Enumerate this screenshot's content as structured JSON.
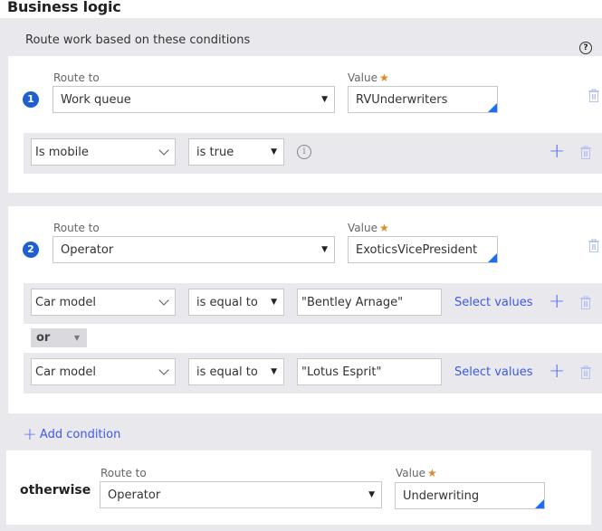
{
  "section_title": "Business logic",
  "subtitle": "Route work based on these conditions",
  "help_icon": "?",
  "labels": {
    "route_to": "Route to",
    "value": "Value",
    "required_marker": "★"
  },
  "routes": [
    {
      "number": "1",
      "route_to": "Work queue",
      "value": "RVUnderwriters",
      "conditions": [
        {
          "field": "Is mobile",
          "operator": "is true",
          "info_icon": "i"
        }
      ]
    },
    {
      "number": "2",
      "route_to": "Operator",
      "value": "ExoticsVicePresident",
      "conditions": [
        {
          "field": "Car model",
          "operator": "is equal to",
          "value": "\"Bentley Arnage\"",
          "select_values": "Select values"
        },
        {
          "field": "Car model",
          "operator": "is equal to",
          "value": "\"Lotus Esprit\"",
          "select_values": "Select values"
        }
      ],
      "joiner": "or"
    }
  ],
  "add_condition": "Add condition",
  "otherwise": {
    "label": "otherwise",
    "route_to": "Operator",
    "value": "Underwriting"
  },
  "colors": {
    "accent": "#1f5fd1",
    "link": "#3d5ae8",
    "required": "#d98b2b",
    "panel_bg": "#e8e8ed"
  }
}
